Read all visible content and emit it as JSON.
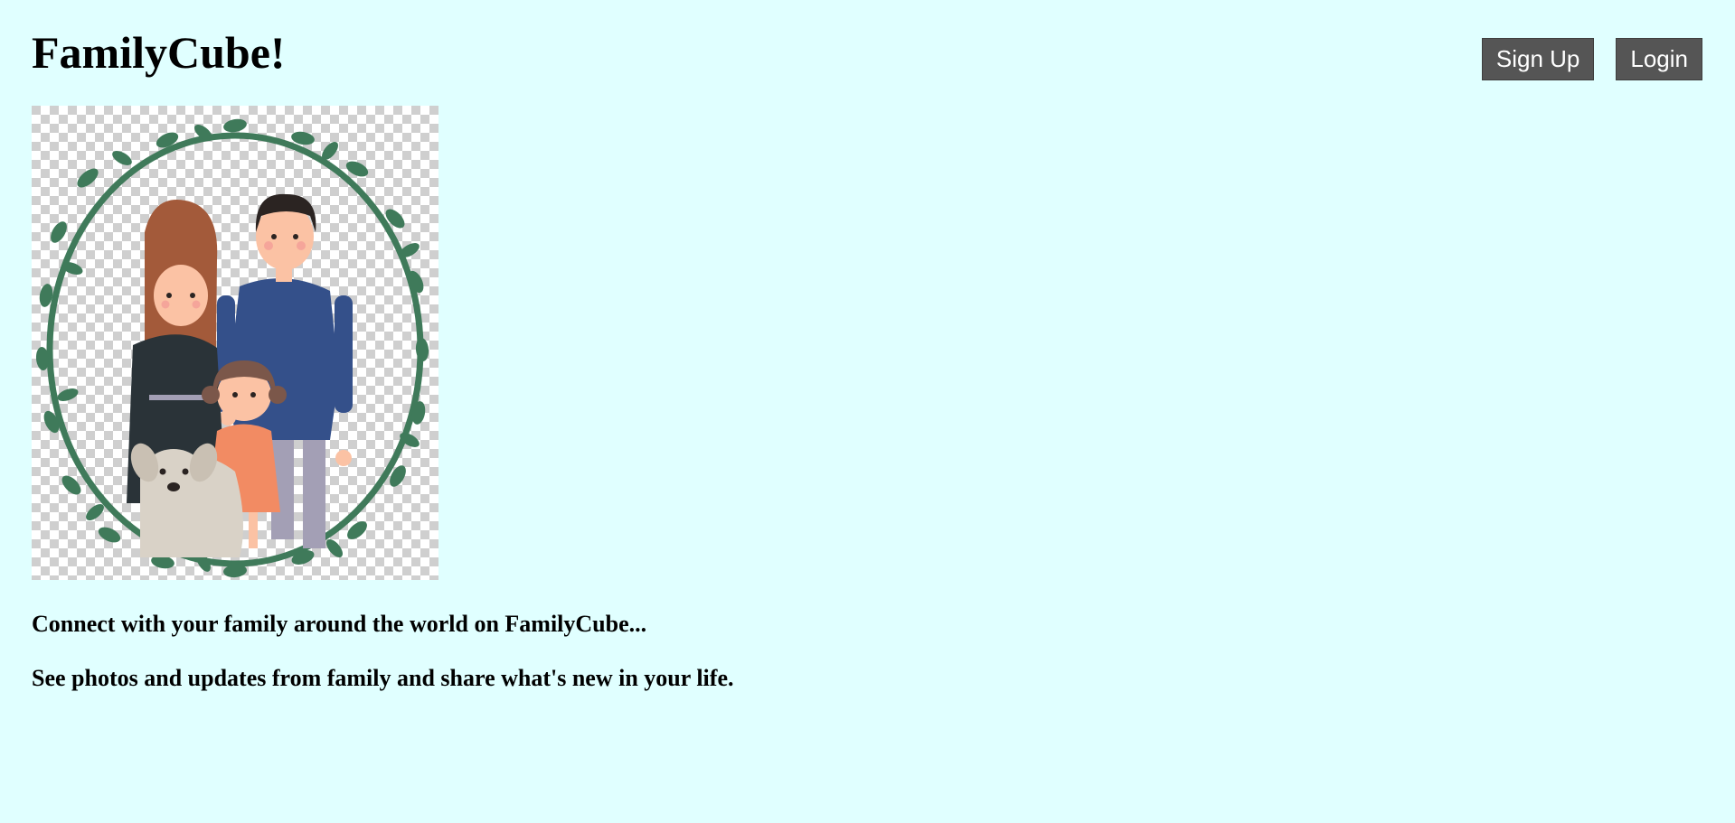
{
  "header": {
    "title": "FamilyCube!",
    "signup_label": "Sign Up",
    "login_label": "Login"
  },
  "hero": {
    "image_icon": "family-portrait-illustration",
    "colors": {
      "wreath": "#3f7a5a",
      "father_shirt": "#34508a",
      "mother_hair": "#a35a3a",
      "girl_dress": "#f28b63"
    }
  },
  "content": {
    "tagline_1": "Connect with your family around the world on FamilyCube...",
    "tagline_2": "See photos and updates from family and share what's new in your life."
  },
  "theme": {
    "background": "#e0ffff",
    "button_bg": "#555555",
    "button_text": "#ffffff"
  }
}
